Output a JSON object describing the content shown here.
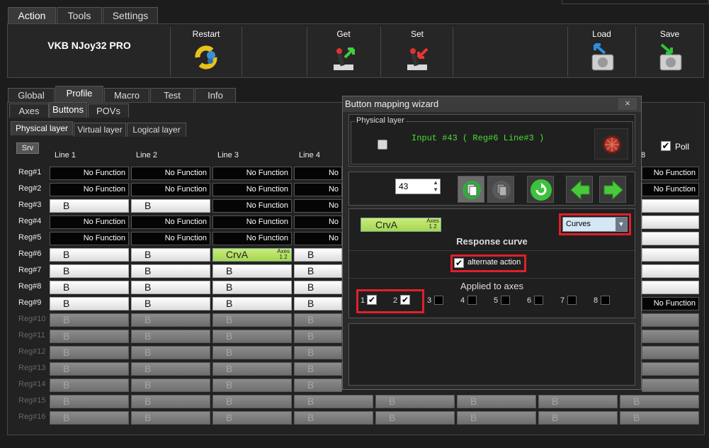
{
  "menu": {
    "tabs": [
      "Action",
      "Tools",
      "Settings"
    ]
  },
  "toolbar": {
    "brand": "VKB NJoy32 PRO",
    "restart_label": "Restart",
    "get_label": "Get",
    "set_label": "Set",
    "load_label": "Load",
    "save_label": "Save"
  },
  "tabs_main": [
    "Global",
    "Profile",
    "Macro",
    "Test",
    "Info"
  ],
  "tabs_sub": [
    "Axes",
    "Buttons",
    "POVs"
  ],
  "tabs_layer": [
    "Physical layer",
    "Virtual layer",
    "Logical layer"
  ],
  "grid": {
    "srv_label": "Srv",
    "poll_label": "Poll",
    "columns": [
      "Line 1",
      "Line 2",
      "Line 3",
      "Line 4"
    ],
    "col8_suffix": "8",
    "rows": [
      "Reg#1",
      "Reg#2",
      "Reg#3",
      "Reg#4",
      "Reg#5",
      "Reg#6",
      "Reg#7",
      "Reg#8",
      "Reg#9",
      "Reg#10",
      "Reg#11",
      "Reg#12",
      "Reg#13",
      "Reg#14",
      "Reg#15",
      "Reg#16"
    ],
    "nofunc": "No Function",
    "nofunc_trunc": "No",
    "b": "B",
    "crv": "CrvA",
    "axes_mini": "Axes",
    "axes_nums": "1 2"
  },
  "wizard": {
    "title": "Button mapping wizard",
    "close": "×",
    "physical_layer_label": "Physical layer",
    "input_text": "Input #43  ( Reg#6   Line#3 )",
    "spin_value": "43",
    "crv_label": "CrvA",
    "axes_mini": "Axes",
    "axes_nums": "1 2",
    "curves_select": "Curves",
    "response_curve": "Response curve",
    "alternate_action": "alternate action",
    "applied_to_axes": "Applied to axes",
    "axes": [
      "1",
      "2",
      "3",
      "4",
      "5",
      "6",
      "7",
      "8"
    ]
  },
  "colors": {
    "highlight": "#e0202a",
    "crv_green": "#b6e264",
    "input_text": "#4ade30"
  }
}
